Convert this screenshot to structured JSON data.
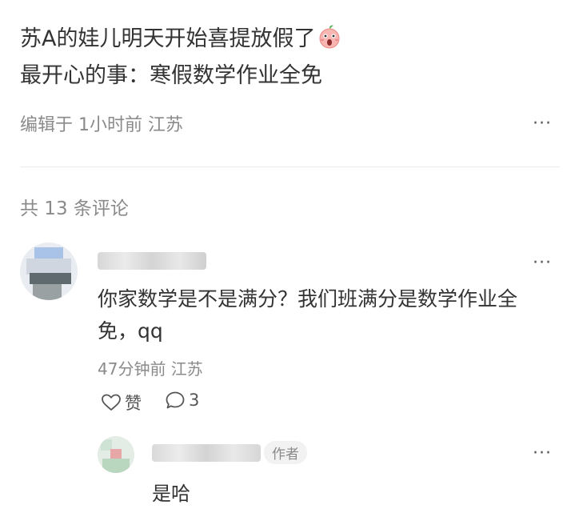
{
  "post": {
    "line1": "苏A的娃儿明天开始喜提放假了",
    "line2": "最开心的事：寒假数学作业全免",
    "meta": "编辑于 1小时前 江苏",
    "more": "···"
  },
  "comments_header": "共 13 条评论",
  "comment": {
    "text": "你家数学是不是满分？我们班满分是数学作业全免，qq",
    "time": "47分钟前 江苏",
    "like_label": "赞",
    "reply_count": "3",
    "more": "···"
  },
  "reply": {
    "author_badge": "作者",
    "text": "是哈",
    "more": "···"
  },
  "colors": {
    "text": "#333333",
    "muted": "#8a8a8a",
    "divider": "#ebebeb",
    "badge_bg": "#f2f2f2"
  },
  "icons": {
    "emoji": "surprised-peach-emoji",
    "like": "heart-outline-icon",
    "reply": "speech-bubble-icon",
    "more": "more-dots-icon"
  }
}
